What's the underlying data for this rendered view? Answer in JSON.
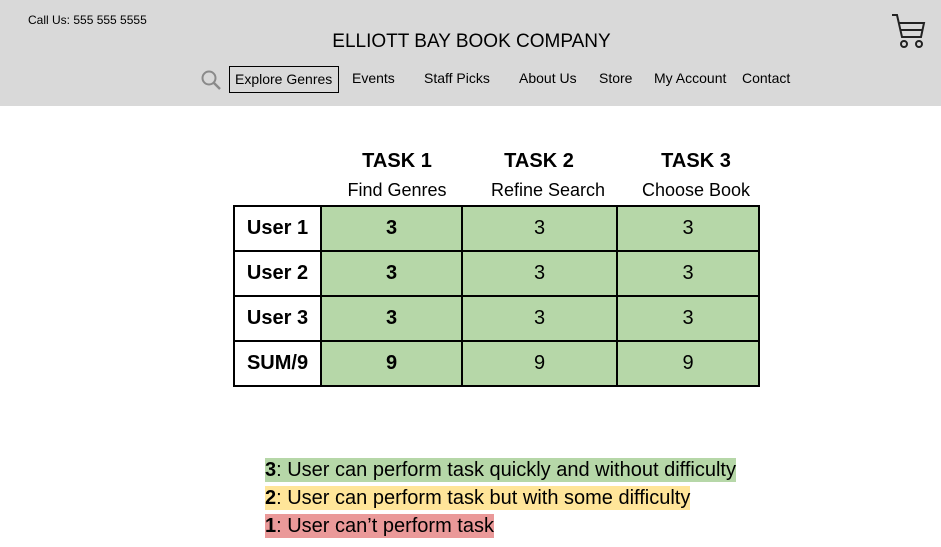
{
  "header": {
    "phone": "Call Us: 555 555 5555",
    "brand": "ELLIOTT BAY BOOK COMPANY",
    "icons": {
      "search": "search-icon",
      "cart": "cart-icon"
    },
    "nav": [
      {
        "label": "Explore Genres",
        "selected": true
      },
      {
        "label": "Events"
      },
      {
        "label": "Staff Picks"
      },
      {
        "label": "About Us"
      },
      {
        "label": "Store"
      },
      {
        "label": "My Account"
      },
      {
        "label": "Contact"
      }
    ]
  },
  "table": {
    "tasks": [
      {
        "title": "TASK 1",
        "subtitle": "Find Genres"
      },
      {
        "title": "TASK 2",
        "subtitle": "Refine Search"
      },
      {
        "title": "TASK 3",
        "subtitle": "Choose Book"
      }
    ],
    "rows": [
      {
        "label": "User 1",
        "values": [
          "3",
          "3",
          "3"
        ]
      },
      {
        "label": "User 2",
        "values": [
          "3",
          "3",
          "3"
        ]
      },
      {
        "label": "User 3",
        "values": [
          "3",
          "3",
          "3"
        ]
      },
      {
        "label": "SUM/9",
        "values": [
          "9",
          "9",
          "9"
        ]
      }
    ]
  },
  "legend": [
    {
      "score": "3",
      "text": ": User can perform task quickly and without difficulty",
      "color": "#b6d7a8"
    },
    {
      "score": "2",
      "text": ": User can perform task but with some difficulty",
      "color": "#ffe599"
    },
    {
      "score": "1",
      "text": ": User can’t perform task",
      "color": "#ea9999"
    }
  ],
  "colors": {
    "header_bg": "#d9d9d9",
    "cell_green": "#b6d7a8"
  }
}
